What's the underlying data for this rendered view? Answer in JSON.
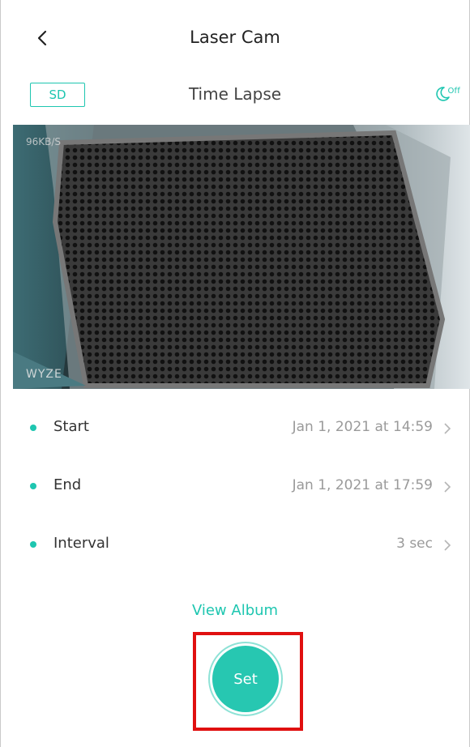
{
  "header": {
    "title": "Laser Cam",
    "back_icon": "chevron-left-icon"
  },
  "subheader": {
    "storage_label": "SD",
    "mode_title": "Time Lapse",
    "night_vision_label": "Off",
    "night_vision_icon": "moon-icon"
  },
  "camera": {
    "overlay_top_left": "96KB/S",
    "watermark": "WYZE"
  },
  "settings": [
    {
      "label": "Start",
      "value": "Jan 1, 2021 at 14:59"
    },
    {
      "label": "End",
      "value": "Jan 1, 2021 at 17:59"
    },
    {
      "label": "Interval",
      "value": "3 sec"
    }
  ],
  "actions": {
    "view_album": "View Album",
    "set": "Set"
  },
  "colors": {
    "accent": "#1ec6b0",
    "highlight": "#e01010"
  }
}
